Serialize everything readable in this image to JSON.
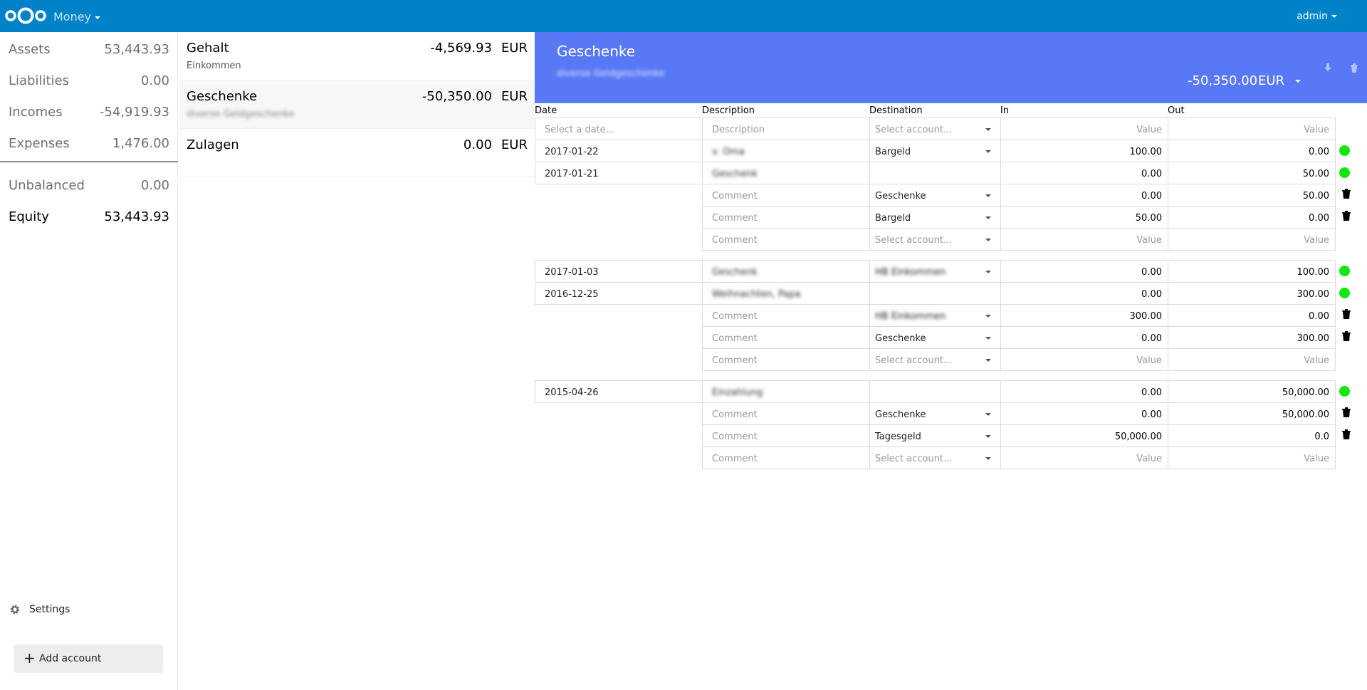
{
  "header": {
    "app_name": "Money",
    "user": "admin",
    "color": "#0082c9"
  },
  "sidebar": {
    "summary": [
      {
        "label": "Assets",
        "value": "53,443.93"
      },
      {
        "label": "Liabilities",
        "value": "0.00"
      },
      {
        "label": "Incomes",
        "value": "-54,919.93"
      },
      {
        "label": "Expenses",
        "value": "1,476.00"
      }
    ],
    "unbalanced": {
      "label": "Unbalanced",
      "value": "0.00"
    },
    "equity": {
      "label": "Equity",
      "value": "53,443.93"
    },
    "settings_label": "Settings",
    "add_account_label": "Add account"
  },
  "accounts": [
    {
      "name": "Gehalt",
      "balance": "-4,569.93",
      "currency": "EUR",
      "description": "Einkommen",
      "description_blurred": false
    },
    {
      "name": "Geschenke",
      "balance": "-50,350.00",
      "currency": "EUR",
      "description": "diverse Geldgeschenke",
      "description_blurred": true
    },
    {
      "name": "Zulagen",
      "balance": "0.00",
      "currency": "EUR",
      "description": "",
      "description_blurred": false
    }
  ],
  "detail": {
    "title": "Geschenke",
    "description": "diverse Geldgeschenke",
    "balance": "-50,350.00",
    "currency": "EUR",
    "header_color": "#5878f6",
    "columns": {
      "date": "Date",
      "description": "Description",
      "destination": "Destination",
      "in": "In",
      "out": "Out"
    },
    "new_row": {
      "date_placeholder": "Select a date...",
      "description_placeholder": "Description",
      "account_placeholder": "Select account...",
      "in_placeholder": "Value",
      "out_placeholder": "Value"
    },
    "split_placeholders": {
      "comment": "Comment",
      "account": "Select account...",
      "value": "Value"
    },
    "status_color": "#12e50f",
    "transactions": [
      {
        "date": "2017-01-22",
        "description": "v. Oma",
        "destination": "Bargeld",
        "in": "100.00",
        "out": "0.00",
        "splits": []
      },
      {
        "date": "2017-01-21",
        "description": "Geschenk",
        "destination": "",
        "in": "0.00",
        "out": "50.00",
        "splits": [
          {
            "comment": "Comment",
            "account": "Geschenke",
            "in": "0.00",
            "out": "50.00"
          },
          {
            "comment": "Comment",
            "account": "Bargeld",
            "in": "50.00",
            "out": "0.00"
          }
        ]
      },
      {
        "date": "2017-01-03",
        "description": "Geschenk",
        "destination": "HB Einkommen",
        "in": "0.00",
        "out": "100.00",
        "splits": []
      },
      {
        "date": "2016-12-25",
        "description": "Weihnachten, Papa",
        "destination": "",
        "in": "0.00",
        "out": "300.00",
        "splits": [
          {
            "comment": "Comment",
            "account": "HB Einkommen",
            "in": "300.00",
            "out": "0.00",
            "account_blurred": true
          },
          {
            "comment": "Comment",
            "account": "Geschenke",
            "in": "0.00",
            "out": "300.00"
          }
        ]
      },
      {
        "date": "2015-04-26",
        "description": "Einzahlung",
        "destination": "",
        "in": "0.00",
        "out": "50,000.00",
        "splits": [
          {
            "comment": "Comment",
            "account": "Geschenke",
            "in": "0.00",
            "out": "50,000.00"
          },
          {
            "comment": "Comment",
            "account": "Tagesgeld",
            "in": "50,000.00",
            "out": "0.0"
          }
        ]
      }
    ]
  }
}
